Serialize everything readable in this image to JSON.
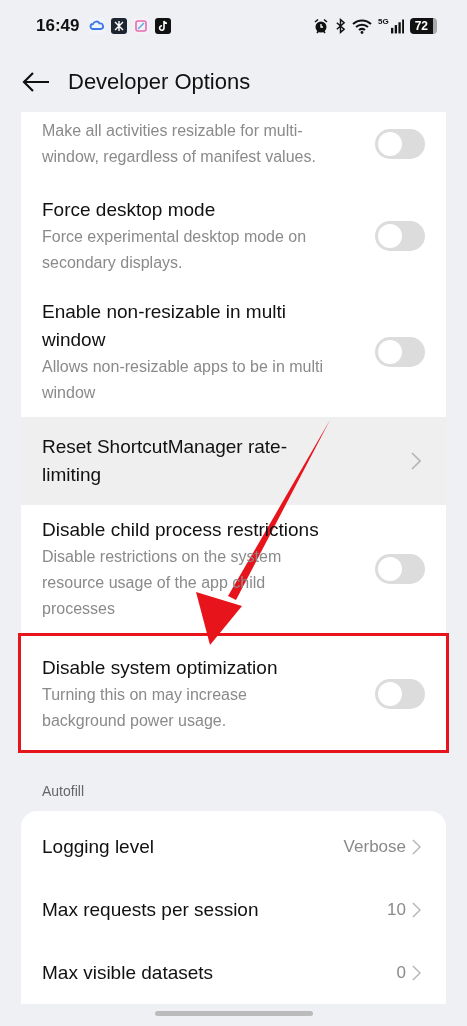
{
  "status_bar": {
    "time": "16:49",
    "battery": "72",
    "network": "5G"
  },
  "header": {
    "title": "Developer Options"
  },
  "items": [
    {
      "kind": "toggle",
      "subtitle": "Make all activities resizable for multi-window, regardless of manifest values.",
      "on": false,
      "highlighted": false,
      "marked": false
    },
    {
      "kind": "toggle",
      "title": "Force desktop mode",
      "subtitle": "Force experimental desktop mode on secondary displays.",
      "on": false,
      "highlighted": false,
      "marked": false
    },
    {
      "kind": "toggle",
      "title": "Enable non-resizable in multi window",
      "subtitle": "Allows non-resizable apps to be in multi window",
      "on": false,
      "highlighted": false,
      "marked": false
    },
    {
      "kind": "link",
      "title": "Reset ShortcutManager rate-limiting",
      "highlighted": true,
      "marked": false
    },
    {
      "kind": "toggle",
      "title": "Disable child process restrictions",
      "subtitle": "Disable restrictions on the system resource usage of the app child processes",
      "on": false,
      "highlighted": false,
      "marked": false
    },
    {
      "kind": "toggle",
      "title": "Disable system optimization",
      "subtitle": "Turning this on may increase background power usage.",
      "on": false,
      "highlighted": false,
      "marked": true
    }
  ],
  "autofill": {
    "label": "Autofill",
    "rows": [
      {
        "title": "Logging level",
        "value": "Verbose"
      },
      {
        "title": "Max requests per session",
        "value": "10"
      },
      {
        "title": "Max visible datasets",
        "value": "0"
      }
    ]
  }
}
